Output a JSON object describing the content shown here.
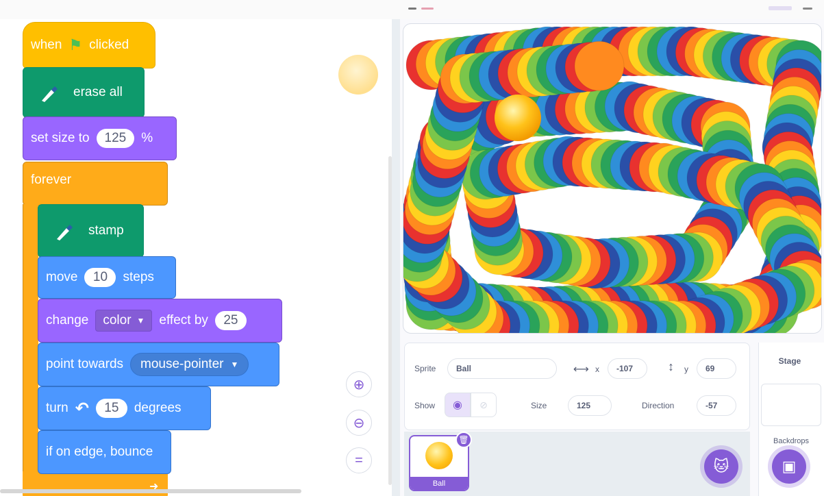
{
  "code": {
    "hat_when": "when",
    "hat_clicked": "clicked",
    "erase_all": "erase all",
    "set_size_label": "set size to",
    "set_size_value": "125",
    "set_size_unit": "%",
    "forever": "forever",
    "stamp": "stamp",
    "move_label": "move",
    "move_value": "10",
    "move_unit": "steps",
    "change_label": "change",
    "change_effect": "color",
    "change_by": "effect by",
    "change_value": "25",
    "point_label": "point towards",
    "point_target": "mouse-pointer",
    "turn_label": "turn",
    "turn_value": "15",
    "turn_unit": "degrees",
    "bounce": "if on edge, bounce"
  },
  "zoom": {
    "zoom_in_icon": "zoom-in-icon",
    "zoom_out_icon": "zoom-out-icon",
    "reset_icon": "zoom-reset-icon"
  },
  "sprite_info": {
    "sprite_label": "Sprite",
    "sprite_name": "Ball",
    "x_label": "x",
    "x_value": "-107",
    "y_label": "y",
    "y_value": "69",
    "show_label": "Show",
    "size_label": "Size",
    "size_value": "125",
    "direction_label": "Direction",
    "direction_value": "-57"
  },
  "sprite_list": {
    "tile_name": "Ball"
  },
  "stage_pane": {
    "title": "Stage",
    "backdrops": "Backdrops"
  },
  "colors": {
    "events": "#ffbf00",
    "pen": "#0e9a6c",
    "looks": "#9966ff",
    "motion": "#4c97ff",
    "control": "#ffab19",
    "accent": "#855cd6",
    "rainbow": [
      "#e8322f",
      "#ff8a1f",
      "#ffd21f",
      "#7bc64a",
      "#2aa35a",
      "#2f8fd8",
      "#2a4fa8"
    ]
  }
}
